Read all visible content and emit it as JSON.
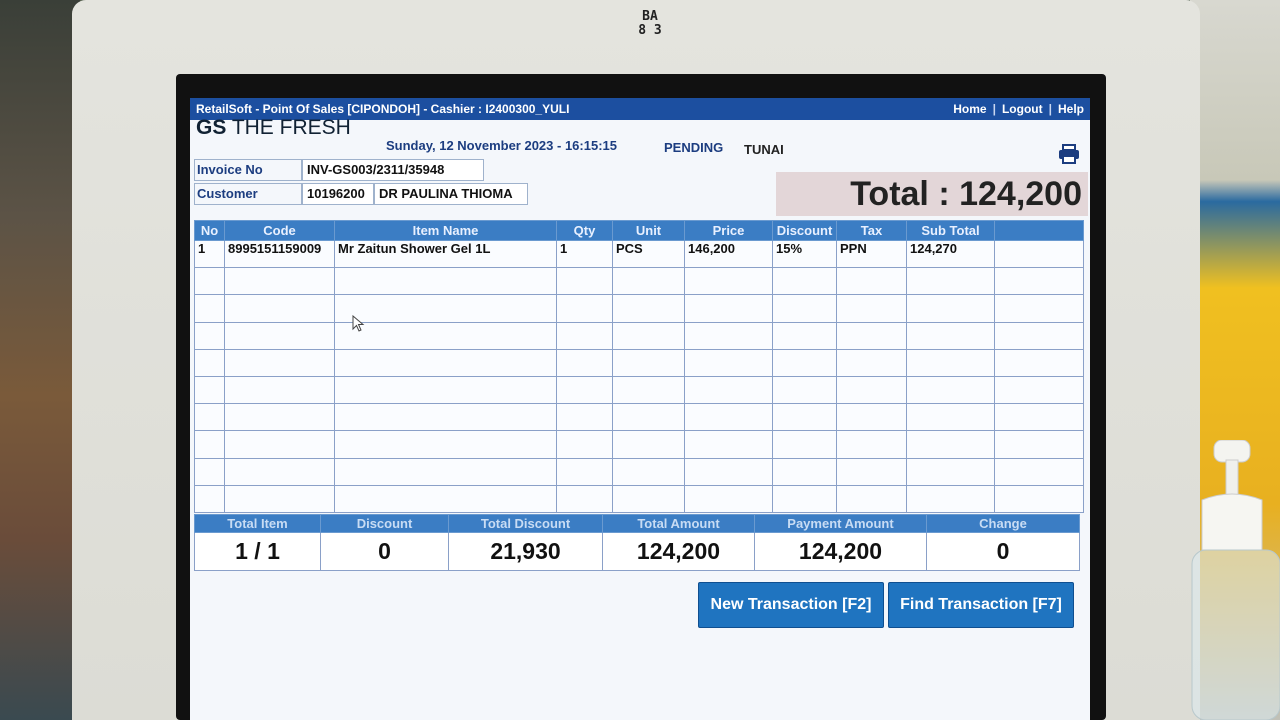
{
  "bezel_label": {
    "line1": "BA",
    "line2": "8 3"
  },
  "titlebar": {
    "text": "RetailSoft - Point Of Sales [CIPONDOH] - Cashier : I2400300_YULI"
  },
  "nav": {
    "home": "Home",
    "logout": "Logout",
    "help": "Help",
    "sep": "|"
  },
  "brand": {
    "prefix": "GS",
    "name": "THE FRESH"
  },
  "header": {
    "datetime": "Sunday, 12 November 2023 - 16:15:15",
    "status": "PENDING",
    "payment_type": "TUNAI"
  },
  "invoice": {
    "label": "Invoice No",
    "value": "INV-GS003/2311/35948"
  },
  "customer": {
    "label": "Customer",
    "id": "10196200",
    "name": "DR PAULINA THIOMA"
  },
  "total_display": "Total : 124,200",
  "table": {
    "headers": [
      "No",
      "Code",
      "Item Name",
      "Qty",
      "Unit",
      "Price",
      "Discount",
      "Tax",
      "Sub Total",
      ""
    ],
    "rows": [
      [
        "1",
        "8995151159009",
        "Mr Zaitun Shower Gel 1L",
        "1",
        "PCS",
        "146,200",
        "15%",
        "PPN",
        "124,270",
        ""
      ]
    ]
  },
  "summary": {
    "headers": [
      "Total Item",
      "Discount",
      "Total Discount",
      "Total Amount",
      "Payment Amount",
      "Change"
    ],
    "values": [
      "1 / 1",
      "0",
      "21,930",
      "124,200",
      "124,200",
      "0"
    ]
  },
  "buttons": {
    "new_transaction": "New Transaction [F2]",
    "find_transaction": "Find Transaction [F7]"
  },
  "colors": {
    "titlebar": "#1c4fa0",
    "header_blue": "#3b7dc4",
    "button_blue": "#1f74c0",
    "total_bg": "#e3d6d8"
  }
}
